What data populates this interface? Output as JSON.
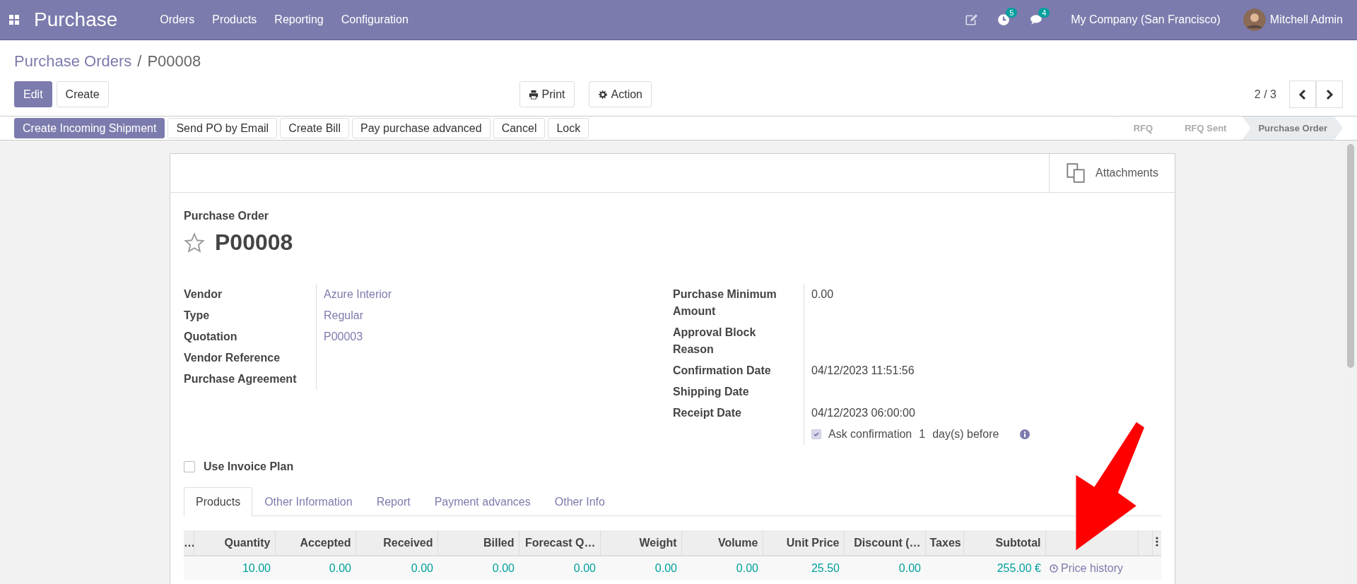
{
  "navbar": {
    "app_name": "Purchase",
    "menu": [
      "Orders",
      "Products",
      "Reporting",
      "Configuration"
    ],
    "activity_count": "5",
    "message_count": "4",
    "company": "My Company (San Francisco)",
    "user": "Mitchell Admin"
  },
  "breadcrumb_separator": "/",
  "breadcrumb": [
    {
      "label": "Purchase Orders",
      "kind": "link"
    },
    {
      "label": "P00008",
      "kind": "current"
    }
  ],
  "control_buttons": [
    {
      "label": "Edit",
      "primary": true
    },
    {
      "label": "Create",
      "primary": false
    }
  ],
  "print": "Print",
  "action": "Action",
  "pager": "2 / 3",
  "header_buttons": [
    {
      "label": "Create Incoming Shipment",
      "primary": true
    },
    {
      "label": "Send PO by Email",
      "primary": false
    },
    {
      "label": "Create Bill",
      "primary": false
    },
    {
      "label": "Pay purchase advanced",
      "primary": false
    },
    {
      "label": "Cancel",
      "primary": false
    },
    {
      "label": "Lock",
      "primary": false
    }
  ],
  "stages": [
    {
      "label": "RFQ",
      "selected": false
    },
    {
      "label": "RFQ Sent",
      "selected": false
    },
    {
      "label": "Purchase Order",
      "selected": true
    }
  ],
  "attachments": "Attachments",
  "form": {
    "subtitle": "Purchase Order",
    "name": "P00008",
    "favorite": false,
    "left_fields": [
      {
        "label": "Vendor",
        "value": "Azure Interior",
        "kind": "link"
      },
      {
        "label": "Type",
        "value": "Regular",
        "kind": "link"
      },
      {
        "label": "Quotation",
        "value": "P00003",
        "kind": "link"
      },
      {
        "label": "Vendor Reference",
        "kind": "empty"
      },
      {
        "label": "Purchase Agreement",
        "kind": "empty"
      }
    ],
    "right_fields": [
      {
        "label": "Purchase Minimum Amount",
        "value": "0.00",
        "kind": "text"
      },
      {
        "label": "Approval Block Reason",
        "kind": "empty"
      },
      {
        "label": "Confirmation Date",
        "value": "04/12/2023 11:51:56",
        "kind": "text"
      },
      {
        "label": "Shipping Date",
        "kind": "empty"
      },
      {
        "label": "Receipt Date",
        "value": "04/12/2023 06:00:00",
        "kind": "text"
      }
    ],
    "ask_confirmation": {
      "checked": true,
      "label": "Ask confirmation",
      "days": "1",
      "suffix": "day(s) before"
    },
    "invoice_plan": {
      "label": "Use Invoice Plan",
      "checked": false
    }
  },
  "tabs": [
    {
      "label": "Products",
      "selected": true
    },
    {
      "label": "Other Information",
      "selected": false
    },
    {
      "label": "Report",
      "selected": false
    },
    {
      "label": "Payment advances",
      "selected": false
    },
    {
      "label": "Other Info",
      "selected": false
    }
  ],
  "table": {
    "columns": [
      {
        "label": "…",
        "kind": "truncated"
      },
      {
        "label": "Quantity",
        "kind": "value"
      },
      {
        "label": "Accepted",
        "kind": "value"
      },
      {
        "label": "Received",
        "kind": "value"
      },
      {
        "label": "Billed",
        "kind": "value"
      },
      {
        "label": "Forecast Q…",
        "kind": "value"
      },
      {
        "label": "Weight",
        "kind": "value"
      },
      {
        "label": "Volume",
        "kind": "value"
      },
      {
        "label": "Unit Price",
        "kind": "value"
      },
      {
        "label": "Discount (…",
        "kind": "value"
      },
      {
        "label": "Taxes",
        "kind": "taxes"
      },
      {
        "label": "Subtotal",
        "kind": "subtotal"
      },
      {
        "kind": "action"
      },
      {
        "kind": "blank"
      },
      {
        "kind": "options"
      }
    ],
    "rows": [
      {
        "cells": [
          "",
          "10.00",
          "0.00",
          "0.00",
          "0.00",
          "0.00",
          "0.00",
          "0.00",
          "25.50",
          "0.00",
          "",
          "255.00 €",
          "Price history"
        ]
      }
    ]
  }
}
